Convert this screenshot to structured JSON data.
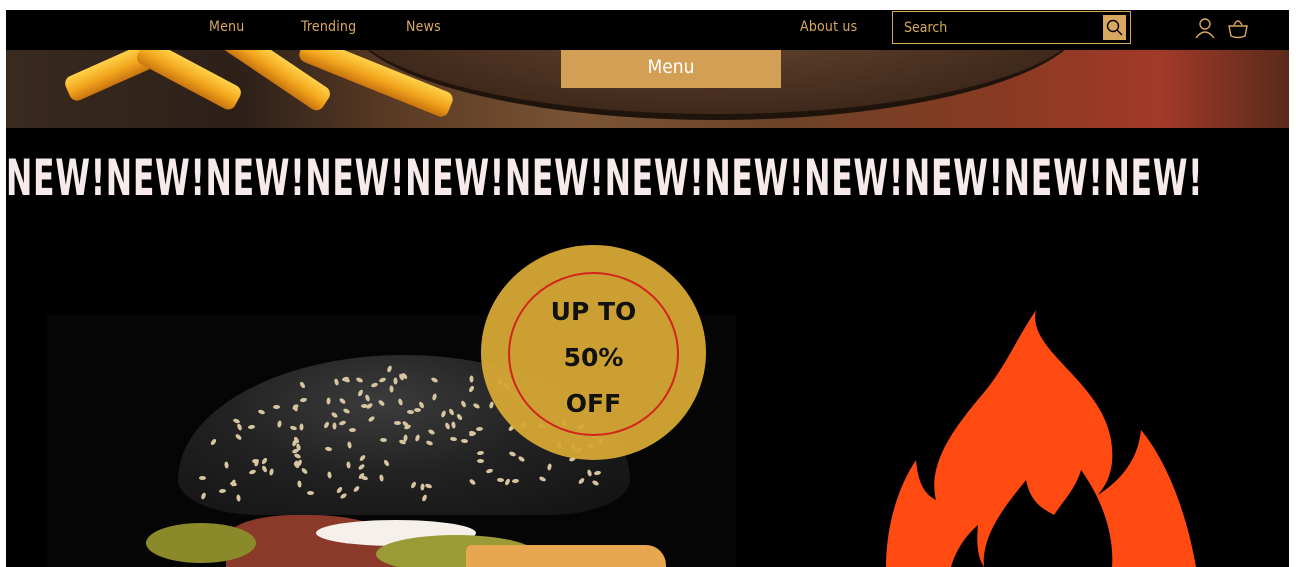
{
  "nav": {
    "links": [
      "Menu",
      "Trending",
      "News",
      "About us"
    ],
    "search": {
      "placeholder": "Search"
    },
    "icons": [
      "search-icon",
      "user-icon",
      "basket-icon"
    ]
  },
  "hero": {
    "menu_banner": "Menu"
  },
  "marquee": {
    "text": "NEW!NEW!NEW!NEW!NEW!NEW!NEW!NEW!NEW!NEW!NEW!NEW!"
  },
  "promo": {
    "badge_lines": [
      "UP TO",
      "50%",
      "OFF"
    ]
  },
  "colors": {
    "accent": "#d9a860",
    "badge": "#d6a834",
    "badge_ring": "#d2231c",
    "flame": "#ff4a12",
    "background": "#000000"
  }
}
